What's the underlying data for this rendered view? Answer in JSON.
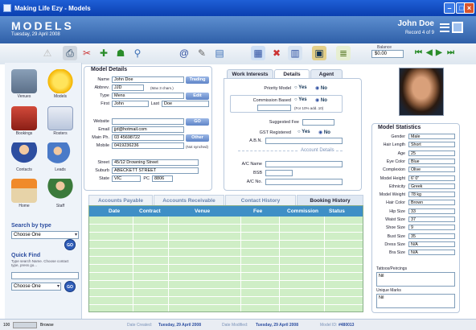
{
  "window": {
    "title": "Making Life Ezy - Models"
  },
  "header": {
    "title": "MODELS",
    "date": "Tuesday, 29 April 2008",
    "user": "John Doe",
    "record": "Record 4 of 9"
  },
  "toolbar": {
    "balance_label": "Balance",
    "balance_value": "$0.00"
  },
  "nav": {
    "items": [
      "Venues",
      "Models",
      "Bookings",
      "Rosters",
      "Contacts",
      "Leads",
      "Home",
      "Staff"
    ]
  },
  "search": {
    "title": "Search by type",
    "choose": "Choose One",
    "go": "GO",
    "quickfind_title": "Quick Find",
    "quickfind_hint": "Type search Name. Choose contact type, press go...",
    "choose2": "Choose One"
  },
  "details": {
    "title": "Model Details",
    "name_label": "Name",
    "name": "John Doe",
    "trading_btn": "Trading",
    "abbrev_label": "Abbrev.",
    "abbrev": "JJD",
    "abbrev_hint": "(Max 3 chars.)",
    "type_label": "Type",
    "type": "Mens",
    "edit_btn": "Edit",
    "first_label": "First",
    "first": "John",
    "last_label": "Last",
    "last": "Doe",
    "website_label": "Website",
    "website": "",
    "go_btn": "GO",
    "email_label": "Email",
    "email": "jjd@hotmail.com",
    "mainph_label": "Main Ph.",
    "mainph": "03 45698722",
    "other_btn": "Other",
    "mobile_label": "Mobile",
    "mobile": "0419236236",
    "mobile_hint": "(Not synched)",
    "street_label": "Street",
    "street": "45/12 Drowning Street",
    "suburb_label": "Suburb",
    "suburb": "ABECKETT STREET",
    "state_label": "State",
    "state": "VIC",
    "pc_label": "PC",
    "pc": "8806"
  },
  "tabs": {
    "interests": "Work Interests",
    "details": "Details",
    "agent": "Agent"
  },
  "detailtab": {
    "priority_label": "Priority Model",
    "yes": "Yes",
    "no": "No",
    "commission_label": "Commission Based",
    "commission_hint": "(For 10% add..10)",
    "suggested_fee_label": "Suggested Fee",
    "gst_label": "GST Registered",
    "abn_label": "A.B.N.",
    "account_details": "Account Details",
    "acname_label": "A/C Name",
    "bsb_label": "BSB",
    "acno_label": "A/C No."
  },
  "bottom_tabs": [
    "Accounts Payable",
    "Accounts Receivable",
    "Contact History",
    "Booking History"
  ],
  "grid": {
    "columns": [
      "Date",
      "Contract",
      "Venue",
      "Fee",
      "Commission",
      "Status"
    ]
  },
  "stats": {
    "title": "Model Statistics",
    "rows": [
      {
        "label": "Gender",
        "value": "Male"
      },
      {
        "label": "Hair Length",
        "value": "Short"
      },
      {
        "label": "Age",
        "value": "25"
      },
      {
        "label": "Eye Color",
        "value": "Blue"
      },
      {
        "label": "Complexion",
        "value": "Olive"
      },
      {
        "label": "Model Height",
        "value": "6' 0\""
      },
      {
        "label": "Ethnicity",
        "value": "Greek"
      },
      {
        "label": "Model Weight",
        "value": "78 kg"
      },
      {
        "label": "Hair Color",
        "value": "Brown"
      },
      {
        "label": "Hip Size",
        "value": "33"
      },
      {
        "label": "Waist Size",
        "value": "37"
      },
      {
        "label": "Shoe Size",
        "value": "9"
      },
      {
        "label": "Bust Size",
        "value": "35"
      },
      {
        "label": "Dress Size",
        "value": "N/A"
      },
      {
        "label": "Bra Size",
        "value": "N/A"
      }
    ],
    "tattoos_label": "Tattoos/Peircings",
    "tattoos": "Nil",
    "marks_label": "Unique Marks",
    "marks": "Nil"
  },
  "status": {
    "zoom": "100",
    "mode": "Browse",
    "created_label": "Date Created:",
    "created": "Tuesday, 29 April 2008",
    "modified_label": "Date Modified:",
    "modified": "Tuesday, 29 April 2008",
    "modelid_label": "Model ID:",
    "modelid": "#480013"
  }
}
